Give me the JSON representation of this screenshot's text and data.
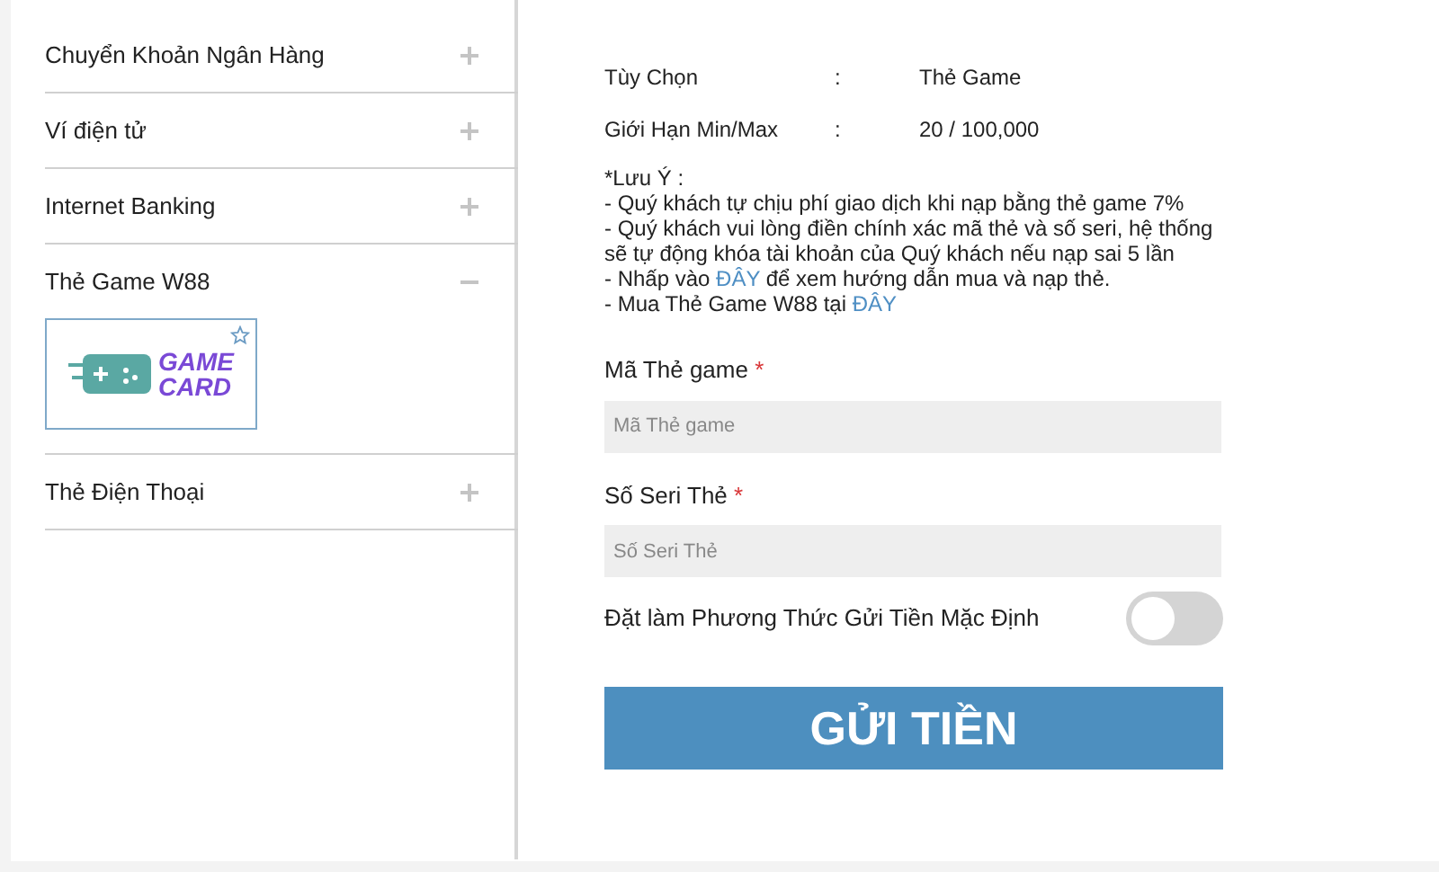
{
  "sidebar": {
    "items": [
      {
        "label": "Chuyển Khoản Ngân Hàng",
        "expanded": false
      },
      {
        "label": "Ví điện tử",
        "expanded": false
      },
      {
        "label": "Internet Banking",
        "expanded": false
      },
      {
        "label": "Thẻ Game W88",
        "expanded": true,
        "card": {
          "logo_lines": [
            "GAME",
            "CARD"
          ]
        }
      },
      {
        "label": "Thẻ Điện Thoại",
        "expanded": false
      }
    ]
  },
  "details": [
    {
      "label": "Tùy Chọn",
      "separator": ":",
      "value": "Thẻ Game"
    },
    {
      "label": "Giới Hạn Min/Max",
      "separator": ":",
      "value": "20 / 100,000"
    }
  ],
  "note": {
    "title": "*Lưu Ý :",
    "lines": [
      [
        {
          "kind": "text",
          "text": "- Quý khách tự chịu phí giao dịch khi nạp bằng thẻ game 7%"
        }
      ],
      [
        {
          "kind": "text",
          "text": "- Quý khách vui lòng điền chính xác mã thẻ và số seri, hệ thống sẽ tự động khóa tài khoản của Quý khách nếu nạp sai 5 lần"
        }
      ],
      [
        {
          "kind": "text",
          "text": "- Nhấp vào "
        },
        {
          "kind": "link",
          "text": "ĐÂY"
        },
        {
          "kind": "text",
          "text": " để xem hướng dẫn mua và nạp thẻ."
        }
      ],
      [
        {
          "kind": "text",
          "text": "- Mua Thẻ Game W88 tại "
        },
        {
          "kind": "link",
          "text": "ĐÂY"
        }
      ]
    ]
  },
  "fields": [
    {
      "label": "Mã Thẻ game",
      "required_mark": "*",
      "placeholder": "Mã Thẻ game"
    },
    {
      "label": "Số Seri Thẻ",
      "required_mark": "*",
      "placeholder": "Số Seri Thẻ"
    }
  ],
  "default_toggle": {
    "label": "Đặt làm Phương Thức Gửi Tiền Mặc Định",
    "on": false
  },
  "submit": "GỬI TIỀN"
}
